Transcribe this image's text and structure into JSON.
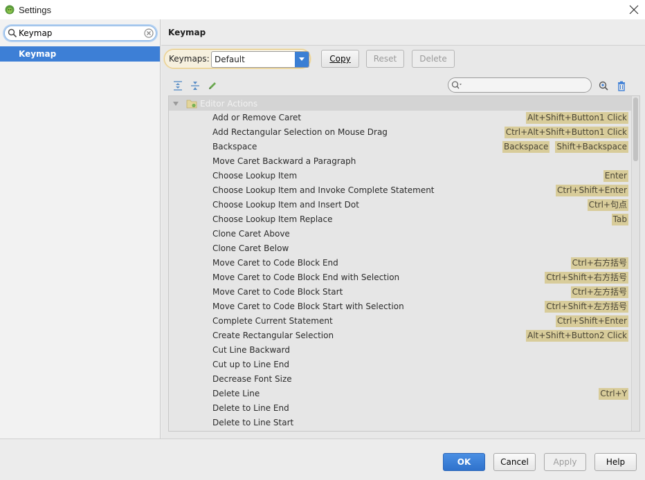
{
  "window": {
    "title": "Settings"
  },
  "sidebar": {
    "search_value": "Keymap",
    "items": [
      {
        "label": "Keymap",
        "selected": true
      }
    ]
  },
  "header": {
    "title": "Keymap"
  },
  "keymaps": {
    "label": "Keymaps:",
    "selected": "Default",
    "copy_label": "Copy",
    "reset_label": "Reset",
    "delete_label": "Delete"
  },
  "tree": {
    "root_label": "Editor Actions",
    "actions": [
      {
        "name": "Add or Remove Caret",
        "shortcuts": [
          "Alt+Shift+Button1 Click"
        ]
      },
      {
        "name": "Add Rectangular Selection on Mouse Drag",
        "shortcuts": [
          "Ctrl+Alt+Shift+Button1 Click"
        ]
      },
      {
        "name": "Backspace",
        "shortcuts": [
          "Backspace",
          "Shift+Backspace"
        ]
      },
      {
        "name": "Move Caret Backward a Paragraph",
        "shortcuts": []
      },
      {
        "name": "Choose Lookup Item",
        "shortcuts": [
          "Enter"
        ]
      },
      {
        "name": "Choose Lookup Item and Invoke Complete Statement",
        "shortcuts": [
          "Ctrl+Shift+Enter"
        ]
      },
      {
        "name": "Choose Lookup Item and Insert Dot",
        "shortcuts": [
          "Ctrl+句点"
        ]
      },
      {
        "name": "Choose Lookup Item Replace",
        "shortcuts": [
          "Tab"
        ]
      },
      {
        "name": "Clone Caret Above",
        "shortcuts": []
      },
      {
        "name": "Clone Caret Below",
        "shortcuts": []
      },
      {
        "name": "Move Caret to Code Block End",
        "shortcuts": [
          "Ctrl+右方括号"
        ]
      },
      {
        "name": "Move Caret to Code Block End with Selection",
        "shortcuts": [
          "Ctrl+Shift+右方括号"
        ]
      },
      {
        "name": "Move Caret to Code Block Start",
        "shortcuts": [
          "Ctrl+左方括号"
        ]
      },
      {
        "name": "Move Caret to Code Block Start with Selection",
        "shortcuts": [
          "Ctrl+Shift+左方括号"
        ]
      },
      {
        "name": "Complete Current Statement",
        "shortcuts": [
          "Ctrl+Shift+Enter"
        ]
      },
      {
        "name": "Create Rectangular Selection",
        "shortcuts": [
          "Alt+Shift+Button2 Click"
        ]
      },
      {
        "name": "Cut Line Backward",
        "shortcuts": []
      },
      {
        "name": "Cut up to Line End",
        "shortcuts": []
      },
      {
        "name": "Decrease Font Size",
        "shortcuts": []
      },
      {
        "name": "Delete Line",
        "shortcuts": [
          "Ctrl+Y"
        ]
      },
      {
        "name": "Delete to Line End",
        "shortcuts": []
      },
      {
        "name": "Delete to Line Start",
        "shortcuts": []
      }
    ]
  },
  "footer": {
    "ok_label": "OK",
    "cancel_label": "Cancel",
    "apply_label": "Apply",
    "help_label": "Help"
  },
  "icons": {
    "app": "android-icon",
    "close": "close-icon",
    "search": "search-icon",
    "clear": "clear-search-icon",
    "expand_all": "expand-all-icon",
    "collapse_all": "collapse-all-icon",
    "edit": "edit-pencil-icon",
    "find_shortcut": "find-shortcut-icon",
    "trash": "trash-icon"
  },
  "colors": {
    "selection_blue": "#3d7fd6",
    "shortcut_badge": "#d8cc9a",
    "ok_button": "#3b7fd4"
  }
}
